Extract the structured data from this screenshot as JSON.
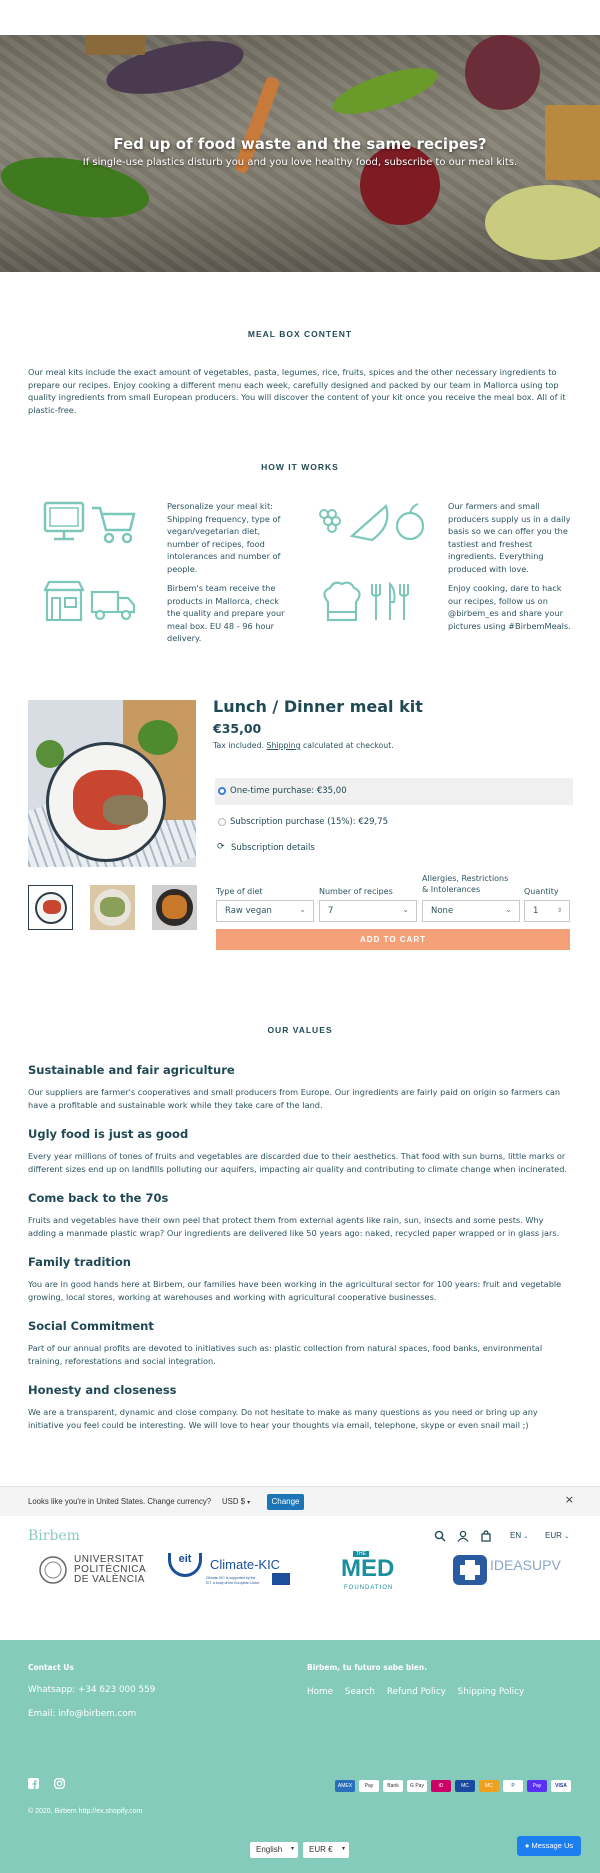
{
  "hero": {
    "title": "Fed up of food waste and the same recipes?",
    "subtitle": "If single-use plastics disturb you and you love healthy food, subscribe to our meal kits."
  },
  "meal_box": {
    "title": "MEAL BOX CONTENT",
    "body": "Our meal kits include the exact amount of vegetables, pasta, legumes, rice, fruits, spices and the other necessary ingredients to prepare our recipes. Enjoy cooking a different menu each week, carefully designed and packed by our team in Mallorca using top quality ingredients from small European producers. You will discover the content of your kit once you receive the meal box. All of it plastic-free."
  },
  "how_it_works": {
    "title": "HOW IT WORKS",
    "steps": [
      {
        "icon": "computer-cart-icon",
        "text": "Personalize your meal kit: Shipping frequency, type of vegan/vegetarian diet, number of recipes, food intolerances and number of people."
      },
      {
        "icon": "fruits-icon",
        "text": "Our farmers and small producers supply us in a daily basis so we can offer you the tastiest and freshest ingredients. Everything produced with love."
      },
      {
        "icon": "shop-truck-icon",
        "text": "Birbem's team receive the products in Mallorca, check the quality and prepare your meal box. EU 48 - 96 hour delivery."
      },
      {
        "icon": "chef-cutlery-icon",
        "text": "Enjoy cooking, dare to hack our recipes, follow us on @birbem_es and share your pictures using #BirbemMeals."
      }
    ]
  },
  "product": {
    "title": "Lunch / Dinner meal kit",
    "price": "€35,00",
    "tax_prefix": "Tax included. ",
    "tax_link": "Shipping",
    "tax_suffix": " calculated at checkout.",
    "one_time": "One-time purchase: €35,00",
    "subscription": "Subscription purchase (15%): €29,75",
    "subscription_details": "Subscription details",
    "fields": [
      {
        "label": "Type of diet",
        "value": "Raw vegan"
      },
      {
        "label": "Number of recipes",
        "value": "7"
      },
      {
        "label": "Allergies, Restrictions & Intolerances",
        "value": "None"
      },
      {
        "label": "Quantity",
        "value": "1"
      }
    ],
    "add_to_cart": "ADD TO CART"
  },
  "values": {
    "title": "OUR VALUES",
    "items": [
      {
        "heading": "Sustainable and fair agriculture",
        "body": "Our suppliers are farmer's cooperatives and small producers from Europe. Our ingredients are fairly paid on origin so farmers can have a profitable and sustainable work while they take care of the land."
      },
      {
        "heading": "Ugly food is just as good",
        "body": "Every year millions of tones of fruits and vegetables are discarded due to their aesthetics. That food with sun burns, little marks or different sizes end up on landfills polluting our aquifers, impacting air quality and contributing to climate change when incinerated."
      },
      {
        "heading": "Come back to the 70s",
        "body": "Fruits and vegetables have their own peel that protect them from external agents like rain, sun, insects and some pests. Why adding a manmade plastic wrap? Our ingredients are delivered like 50 years ago: naked, recycled paper wrapped or in glass jars."
      },
      {
        "heading": "Family tradition",
        "body": "You are in good hands here at Birbem, our families have been working in the agricultural sector for 100 years: fruit and vegetable growing, local stores, working at warehouses and working with agricultural cooperative businesses."
      },
      {
        "heading": "Social Commitment",
        "body": "Part of our annual profits are devoted to initiatives such as: plastic collection from natural spaces, food banks, environmental training, reforestations and social integration."
      },
      {
        "heading": "Honesty and closeness",
        "body": "We are a transparent, dynamic and close company. Do not hesitate to make as many questions as you need or bring up any initiative you feel could be interesting. We will love to hear your thoughts via email, telephone, skype or even snail mail ;)"
      }
    ]
  },
  "currency_bar": {
    "text": "Looks like you're in United States. Change currency?",
    "currency": "USD $",
    "button": "Change",
    "close": "×"
  },
  "nav": {
    "logo": "Birbem",
    "lang": "EN",
    "currency": "EUR"
  },
  "partners": {
    "upv": [
      "UNIVERSITAT",
      "POLITÈCNICA",
      "DE VALÈNCIA"
    ],
    "climate": "Climate-KIC",
    "climate_eit": "eit",
    "climate_note1": "Climate-KIC is supported by the",
    "climate_note2": "EIT, a body of the European Union",
    "med_top": "THE",
    "med": "MED",
    "med_sub": "FOUNDATION",
    "ideas": "IDEASUPV"
  },
  "footer": {
    "contact_title": "Contact Us",
    "whatsapp": "Whatsapp: +34 623 000 559",
    "email": "Email: info@birbem.com",
    "tagline": "Birbem, tu futuro sabe bien.",
    "links": [
      "Home",
      "Search",
      "Refund Policy",
      "Shipping Policy"
    ],
    "payments": [
      "AMEX",
      "Pay",
      "Bank",
      "G Pay",
      "iD",
      "MC",
      "MC",
      "P",
      "Pay",
      "VISA"
    ],
    "copyright": "© 2020, Birbem http://ex.shopify.com",
    "lang_select": "English",
    "cur_select": "EUR €",
    "message": "Message Us"
  }
}
